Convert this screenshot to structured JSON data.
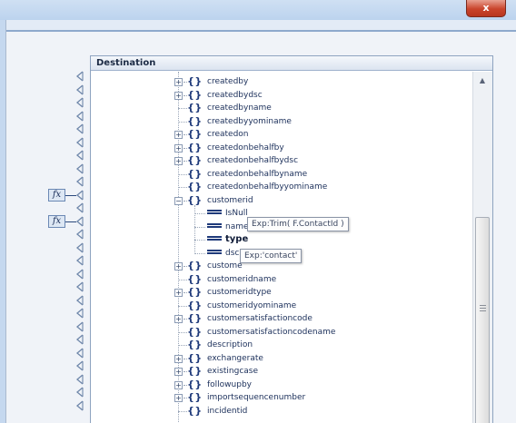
{
  "window": {
    "close_glyph": "x"
  },
  "destination": {
    "header": "Destination"
  },
  "tree_items": [
    {
      "label": "createdby",
      "expandable": true
    },
    {
      "label": "createdbydsc",
      "expandable": true
    },
    {
      "label": "createdbyname",
      "expandable": false
    },
    {
      "label": "createdbyyominame",
      "expandable": false
    },
    {
      "label": "createdon",
      "expandable": true
    },
    {
      "label": "createdonbehalfby",
      "expandable": true
    },
    {
      "label": "createdonbehalfbydsc",
      "expandable": true
    },
    {
      "label": "createdonbehalfbyname",
      "expandable": false
    },
    {
      "label": "createdonbehalfbyyominame",
      "expandable": false
    },
    {
      "label": "customerid",
      "expandable": true,
      "expanded": true
    }
  ],
  "customerid_children": [
    {
      "label": "IsNull",
      "bold": false
    },
    {
      "label": "name",
      "bold": false
    },
    {
      "label": "type",
      "bold": true
    },
    {
      "label": "dsc",
      "bold": false
    }
  ],
  "tree_items_after": [
    {
      "label": "custome",
      "expandable": true
    },
    {
      "label": "customeridname",
      "expandable": false
    },
    {
      "label": "customeridtype",
      "expandable": true
    },
    {
      "label": "customeridyominame",
      "expandable": false
    },
    {
      "label": "customersatisfactioncode",
      "expandable": true
    },
    {
      "label": "customersatisfactioncodename",
      "expandable": false
    },
    {
      "label": "description",
      "expandable": false
    },
    {
      "label": "exchangerate",
      "expandable": true
    },
    {
      "label": "existingcase",
      "expandable": true
    },
    {
      "label": "followupby",
      "expandable": true
    },
    {
      "label": "importsequencenumber",
      "expandable": true
    },
    {
      "label": "incidentid",
      "expandable": false
    }
  ],
  "tooltips": {
    "name_expression": "Exp:Trim( F.ContactId )",
    "dsc_expression": "Exp:'contact'"
  },
  "function_boxes": {
    "label": "fx"
  },
  "scrollbar": {
    "up_arrow": "▲",
    "position": 0.45
  }
}
